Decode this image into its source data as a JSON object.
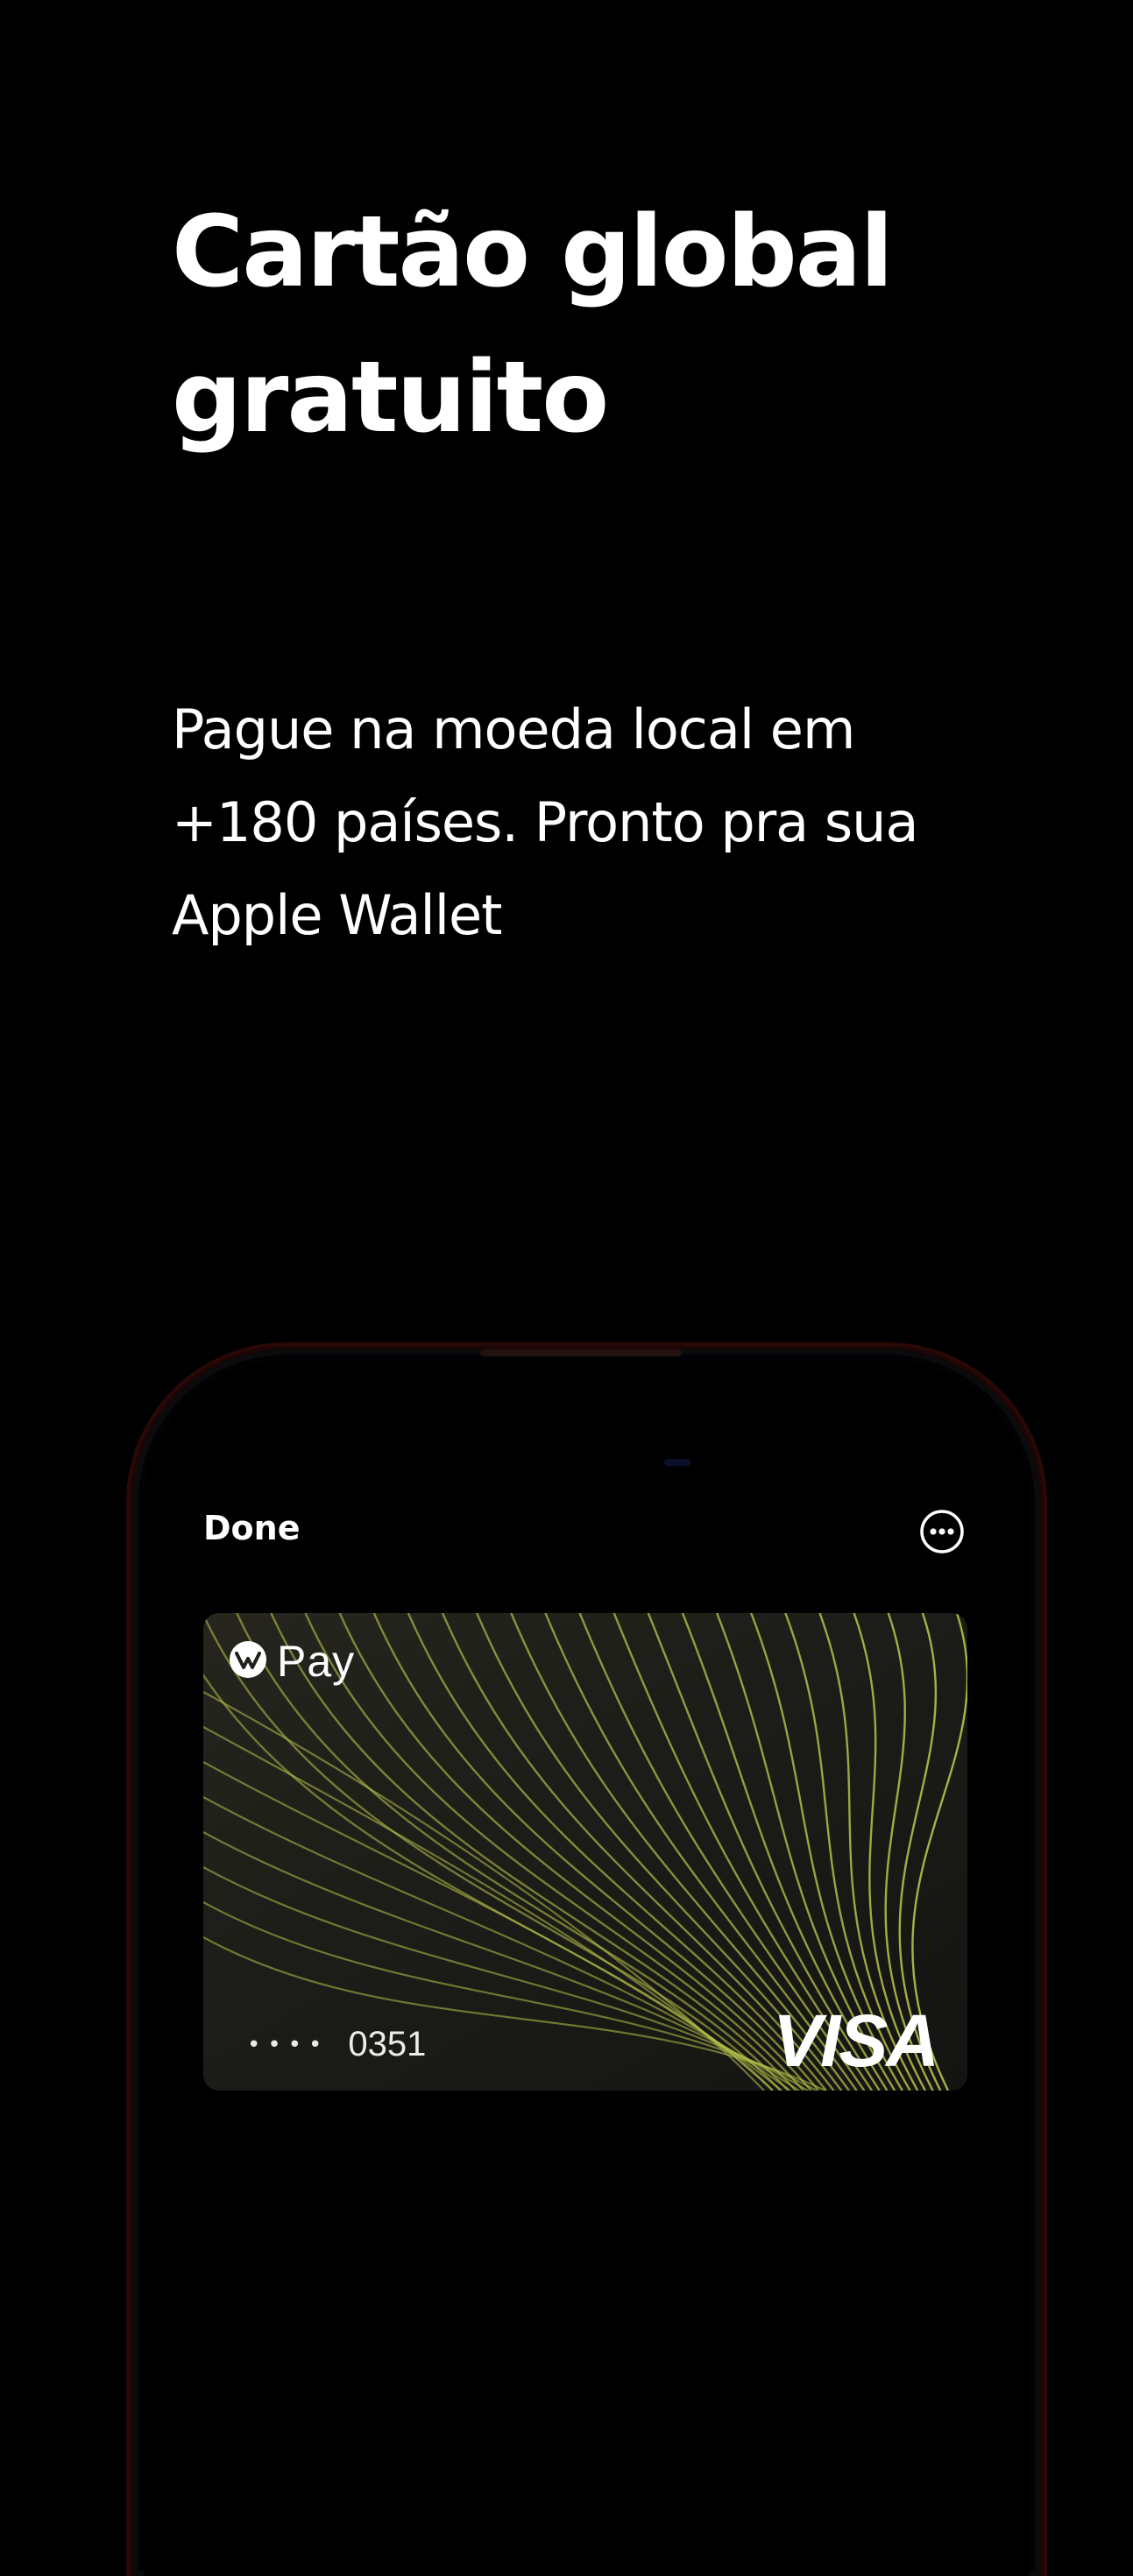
{
  "headline": {
    "line1": "Cartão global",
    "line2": "gratuito"
  },
  "subtitle": {
    "line1": "Pague na moeda local em",
    "line2": "+180 países. Pronto pra sua",
    "line3": "Apple Wallet"
  },
  "wallet": {
    "done_label": "Done",
    "more_icon": "ellipsis-circle-icon",
    "card": {
      "brand_label": "Pay",
      "brand_icon": "wise-logo-icon",
      "masked_dots": "••••",
      "last4": "0351",
      "network": "VISA",
      "wave_color": "#b8c24a",
      "background_color": "#1f1f1b"
    }
  },
  "colors": {
    "background": "#000000",
    "text": "#ffffff",
    "phone_frame_accent": "#2a0806"
  }
}
